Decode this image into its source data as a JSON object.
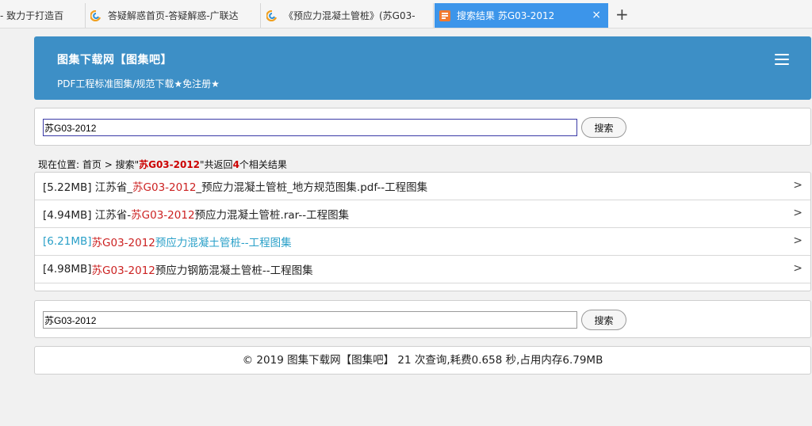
{
  "tabs": [
    {
      "title": "- 致力于打造百"
    },
    {
      "title": "答疑解惑首页-答疑解惑-广联达"
    },
    {
      "title": "《预应力混凝土管桩》(苏G03-"
    },
    {
      "title": "搜索结果 苏G03-2012",
      "close": "×"
    }
  ],
  "new_tab": "+",
  "header": {
    "site_title": "图集下载网【图集吧】",
    "subtitle": "PDF工程标准图集/规范下载★免注册★"
  },
  "search": {
    "value": "苏G03-2012",
    "button": "搜索"
  },
  "breadcrumb": {
    "prefix": "现在位置: ",
    "home": "首页",
    "sep": " > ",
    "search_label": "搜索\"",
    "keyword": "苏G03-2012",
    "mid": "\"共返回",
    "count": "4",
    "suffix": "个相关结果"
  },
  "results": [
    {
      "pre": "[5.22MB] 江苏省_",
      "hl": "苏G03-2012",
      "post": "_预应力混凝土管桩_地方规范图集.pdf--工程图集",
      "arrow": ">"
    },
    {
      "pre": "[4.94MB] 江苏省-",
      "hl": "苏G03-2012",
      "post": "预应力混凝土管桩.rar--工程图集",
      "arrow": ">"
    },
    {
      "pre": "[6.21MB] ",
      "hl": "苏G03-2012",
      "post": "预应力混凝土管桩--工程图集",
      "arrow": ">"
    },
    {
      "pre": "[4.98MB] ",
      "hl": "苏G03-2012",
      "post": "预应力钢筋混凝土管桩--工程图集",
      "arrow": ">"
    }
  ],
  "footer": {
    "text": "© 2019  图集下载网【图集吧】  21 次查询,耗费0.658 秒,占用内存6.79MB"
  },
  "colors": {
    "header_bg": "#3d8fc6",
    "active_tab": "#3c95ea",
    "highlight": "#cc2222",
    "visited_link": "#2aa0c8"
  }
}
